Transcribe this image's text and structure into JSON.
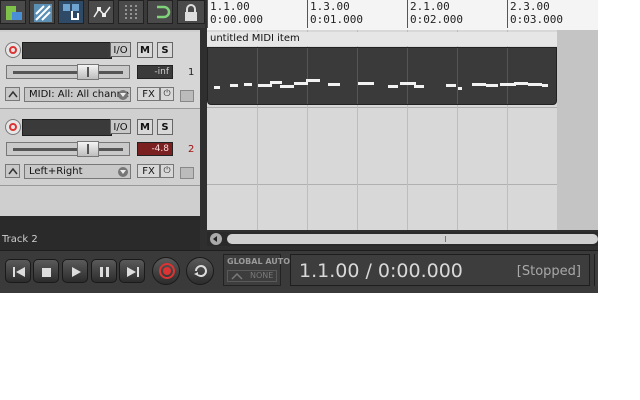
{
  "ruler": {
    "marks": [
      {
        "beat": "1.1.00",
        "time": "0:00.000"
      },
      {
        "beat": "1.3.00",
        "time": "0:01.000"
      },
      {
        "beat": "2.1.00",
        "time": "0:02.000"
      },
      {
        "beat": "2.3.00",
        "time": "0:03.000"
      }
    ]
  },
  "tracks": [
    {
      "number": "1",
      "io_label": "I/O",
      "mute_label": "M",
      "solo_label": "S",
      "volume": "-inf",
      "input": "MIDI: All: All channe",
      "fx_label": "FX"
    },
    {
      "number": "2",
      "io_label": "I/O",
      "mute_label": "M",
      "solo_label": "S",
      "volume": "-4.8",
      "input": "Left+Right",
      "fx_label": "FX"
    }
  ],
  "selected_track_label": "Track 2",
  "midi_item": {
    "title": "untitled MIDI item"
  },
  "global_auto": {
    "title": "GLOBAL AUTO",
    "mode": "NONE"
  },
  "transport": {
    "position": "1.1.00 / 0:00.000",
    "state": "[Stopped]"
  },
  "colors": {
    "volume_meter_clip": "#7a2020",
    "record_red": "#d33333",
    "midi_notes": "#f2f2f2"
  }
}
